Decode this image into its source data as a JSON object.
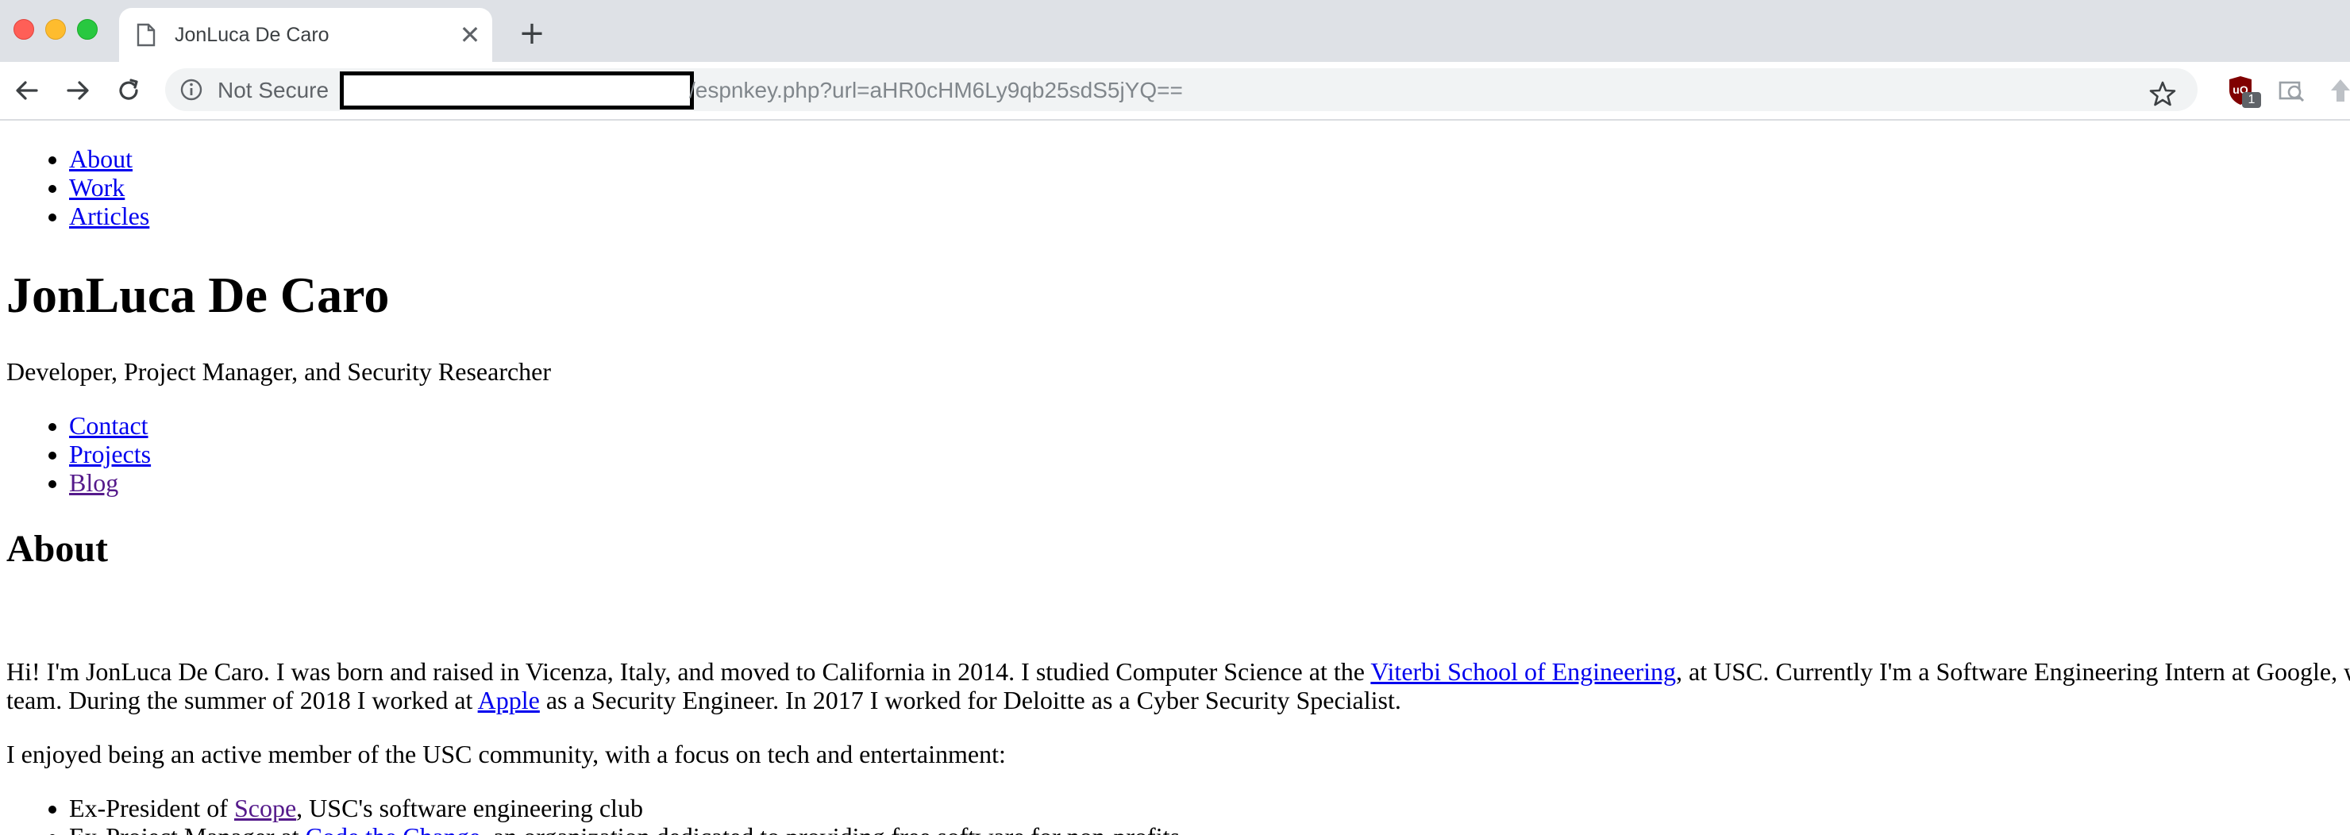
{
  "browser": {
    "tab_title": "JonLuca De Caro",
    "tab_close": "✕",
    "new_tab": "+",
    "security_label": "Not Secure",
    "url_visible": "/espnkey.php?url=aHR0cHM6Ly9qb25sdS5jYQ==",
    "extension_badge": "1",
    "colors": {
      "tabbar": "#dee1e6",
      "omnibox": "#f1f3f4",
      "link": "#0000ee",
      "visited_link": "#551a8b",
      "ublock": "#800000"
    }
  },
  "page": {
    "nav_top": [
      {
        "label": "About"
      },
      {
        "label": "Work"
      },
      {
        "label": "Articles"
      }
    ],
    "name": "JonLuca De Caro",
    "tagline": "Developer, Project Manager, and Security Researcher",
    "nav_secondary": [
      {
        "label": "Contact"
      },
      {
        "label": "Projects"
      },
      {
        "label": "Blog",
        "visited": true
      }
    ],
    "about_heading": "About",
    "bio": {
      "p1": "Hi! I'm JonLuca De Caro. I was born and raised in Vicenza, Italy, and moved to California in 2014. I studied Computer Science at the ",
      "link_viterbi": "Viterbi School of Engineering",
      "p2": ", at USC. Currently I'm a Software Engineering Intern at Google, w",
      "p3": "team. During the summer of 2018 I worked at ",
      "link_apple": "Apple",
      "p4": " as a Security Engineer. In 2017 I worked for Deloitte as a Cyber Security Specialist."
    },
    "usc_intro": "I enjoyed being an active member of the USC community, with a focus on tech and entertainment:",
    "usc_items": [
      {
        "prefix": "Ex-President of ",
        "link": "Scope",
        "suffix": ", USC's software engineering club"
      },
      {
        "prefix": "Ex-Project Manager at ",
        "link": "Code the Change",
        "suffix": ", an organization dedicated to providing free software for non-profits"
      }
    ]
  }
}
